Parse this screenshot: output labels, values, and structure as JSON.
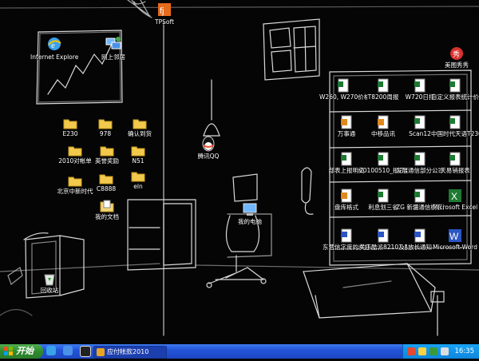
{
  "desktop_icons": [
    {
      "id": "ie",
      "label": "Internet Explorer",
      "icon": "ie-icon"
    },
    {
      "id": "network",
      "label": "网上邻居",
      "icon": "network-places-icon"
    },
    {
      "id": "tp",
      "label": "TPSoft",
      "icon": "tp-app-icon"
    },
    {
      "id": "meitu",
      "label": "美图秀秀",
      "icon": "meitu-icon"
    },
    {
      "id": "f1",
      "label": "E230",
      "icon": "folder-icon"
    },
    {
      "id": "f2",
      "label": "978",
      "icon": "folder-icon"
    },
    {
      "id": "f3",
      "label": "确认到货",
      "icon": "folder-icon"
    },
    {
      "id": "f4",
      "label": "2010对帐单",
      "icon": "folder-icon"
    },
    {
      "id": "f5",
      "label": "英誉奖励",
      "icon": "folder-icon"
    },
    {
      "id": "f6",
      "label": "N51",
      "icon": "folder-icon"
    },
    {
      "id": "f7",
      "label": "北京中新时代",
      "icon": "folder-icon"
    },
    {
      "id": "f8",
      "label": "C8888",
      "icon": "folder-icon"
    },
    {
      "id": "f9",
      "label": "eln",
      "icon": "folder-icon"
    },
    {
      "id": "mydocs",
      "label": "我的文档",
      "icon": "my-documents-icon"
    },
    {
      "id": "qq",
      "label": "腾讯QQ",
      "icon": "qq-icon"
    },
    {
      "id": "mycomp",
      "label": "我的电脑",
      "icon": "my-computer-icon"
    },
    {
      "id": "recycle",
      "label": "回收站",
      "icon": "recycle-bin-icon"
    },
    {
      "id": "s1",
      "label": "W260, W270价格",
      "icon": "excel-icon"
    },
    {
      "id": "s2",
      "label": "T8200周报",
      "icon": "excel-icon"
    },
    {
      "id": "s3",
      "label": "W720日报",
      "icon": "excel-icon"
    },
    {
      "id": "s4",
      "label": "自定义报表统计价格",
      "icon": "excel-icon"
    },
    {
      "id": "s5",
      "label": "万事通",
      "icon": "sheet-orange-icon"
    },
    {
      "id": "s6",
      "label": "中移品讯",
      "icon": "sheet-orange-icon"
    },
    {
      "id": "s7",
      "label": "Scan12",
      "icon": "excel-icon"
    },
    {
      "id": "s8",
      "label": "中国时代天语T230汇总信息",
      "icon": "excel-icon"
    },
    {
      "id": "s9",
      "label": "部表上报明细",
      "icon": "excel-icon"
    },
    {
      "id": "s10",
      "label": "20100510_报表要求",
      "icon": "excel-icon"
    },
    {
      "id": "s11",
      "label": "发展通信部分公司员工",
      "icon": "excel-icon"
    },
    {
      "id": "s12",
      "label": "天易销报表",
      "icon": "excel-icon"
    },
    {
      "id": "s13",
      "label": "盘库格式",
      "icon": "sheet-orange-icon"
    },
    {
      "id": "s14",
      "label": "利息划三省",
      "icon": "excel-icon"
    },
    {
      "id": "s15",
      "label": "ZG 新疆通信模板及物料",
      "icon": "excel-icon"
    },
    {
      "id": "s16",
      "label": "Microsoft Excel",
      "icon": "excel-app-icon"
    },
    {
      "id": "s17",
      "label": "东营信字度的奖励方案",
      "icon": "word-icon"
    },
    {
      "id": "s18",
      "label": "关于酷派8210及酷派8310",
      "icon": "word-icon"
    },
    {
      "id": "s19",
      "label": "放长通知",
      "icon": "word-icon"
    },
    {
      "id": "s20",
      "label": "Microsoft Word",
      "icon": "word-app-icon"
    }
  ],
  "taskbar": {
    "start_label": "开始",
    "task_label": "应付帐款2010",
    "clock": "16:35"
  },
  "colors": {
    "taskbar": "#245edb",
    "start": "#3c9a3c",
    "tray": "#0f8ddf",
    "excel": "#1e7a32",
    "word": "#2b55c4",
    "folder": "#f2c94c"
  }
}
